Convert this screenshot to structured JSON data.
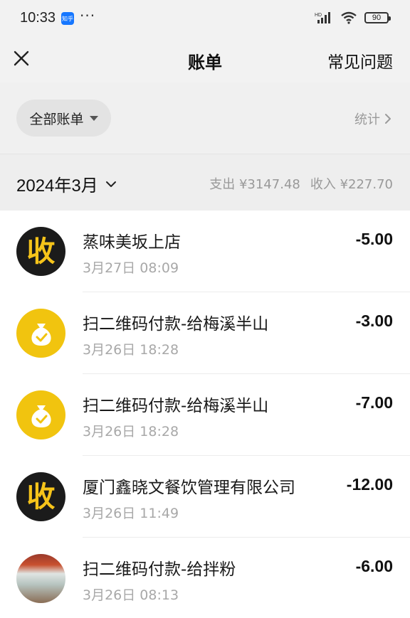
{
  "status": {
    "time": "10:33",
    "app_badge": "知乎",
    "battery": "90"
  },
  "nav": {
    "title": "账单",
    "faq_label": "常见问题"
  },
  "filter": {
    "label": "全部账单",
    "stats_label": "统计"
  },
  "month": {
    "label": "2024年3月",
    "expense": "支出 ¥3147.48",
    "income": "收入 ¥227.70"
  },
  "transactions": [
    {
      "title": "蒸味美坂上店",
      "date": "3月27日 08:09",
      "amount": "-5.00",
      "icon": "shou-icon"
    },
    {
      "title": "扫二维码付款-给梅溪半山",
      "date": "3月26日 18:28",
      "amount": "-3.00",
      "icon": "money-bag-icon"
    },
    {
      "title": "扫二维码付款-给梅溪半山",
      "date": "3月26日 18:28",
      "amount": "-7.00",
      "icon": "money-bag-icon"
    },
    {
      "title": "厦门鑫晓文餐饮管理有限公司",
      "date": "3月26日 11:49",
      "amount": "-12.00",
      "icon": "shou-icon"
    },
    {
      "title": "扫二维码付款-给拌粉",
      "date": "3月26日 08:13",
      "amount": "-6.00",
      "icon": "shop-photo"
    }
  ],
  "icons": {
    "shou_char": "收"
  },
  "colors": {
    "accent_yellow": "#f1c40f",
    "shou_bg": "#1b1b1b",
    "shou_fg": "#f6c41a"
  }
}
